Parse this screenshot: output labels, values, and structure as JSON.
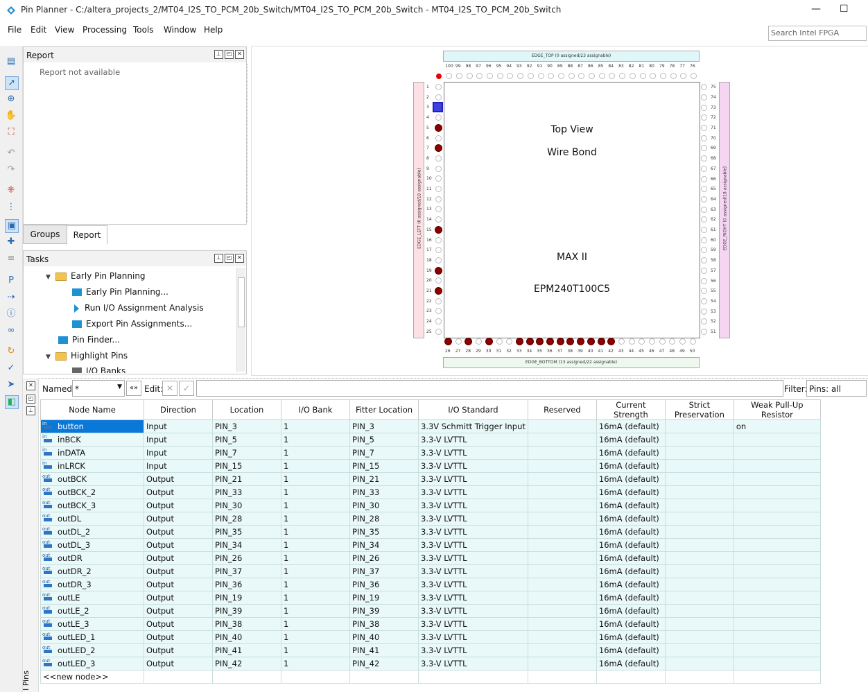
{
  "window": {
    "title": "Pin Planner - C:/altera_projects_2/MT04_I2S_TO_PCM_20b_Switch/MT04_I2S_TO_PCM_20b_Switch - MT04_I2S_TO_PCM_20b_Switch",
    "minimize": "—",
    "maximize": "☐"
  },
  "menu": [
    "File",
    "Edit",
    "View",
    "Processing",
    "Tools",
    "Window",
    "Help"
  ],
  "search": {
    "placeholder": "Search Intel FPGA"
  },
  "report_panel": {
    "title": "Report",
    "message": "Report not available"
  },
  "tabs": {
    "groups": "Groups",
    "report": "Report"
  },
  "tasks_panel": {
    "title": "Tasks",
    "items": [
      {
        "label": "Early Pin Planning"
      },
      {
        "label": "Early Pin Planning..."
      },
      {
        "label": "Run I/O Assignment Analysis"
      },
      {
        "label": "Export Pin Assignments..."
      },
      {
        "label": "Pin Finder..."
      },
      {
        "label": "Highlight Pins"
      },
      {
        "label": "I/O Banks"
      }
    ]
  },
  "chip": {
    "edge_top": "EDGE_TOP (0 assigned/23 assignable)",
    "edge_bottom": "EDGE_BOTTOM (13 assigned/22 assignable)",
    "edge_left": "EDGE_LEFT (6 assigned/18 assignable)",
    "edge_right": "EDGE_RIGHT (0 assigned/18 assignable)",
    "top_view": "Top View",
    "wire_bond": "Wire Bond",
    "family": "MAX II",
    "device": "EPM240T100C5",
    "used_pins_left": [
      3,
      5,
      7,
      15,
      19,
      21
    ],
    "used_pins_bottom": [
      26,
      28,
      30,
      33,
      34,
      35,
      36,
      37,
      38,
      39,
      40,
      41,
      42
    ]
  },
  "filter": {
    "named_label": "Named:",
    "named_value": "*",
    "edit_label": "Edit:",
    "filter_label": "Filter:",
    "filter_value": "Pins: all"
  },
  "table": {
    "columns": [
      "Node Name",
      "Direction",
      "Location",
      "I/O Bank",
      "Fitter Location",
      "I/O Standard",
      "Reserved",
      "Current Strength",
      "Strict Preservation",
      "Weak Pull-Up Resistor"
    ],
    "rows": [
      {
        "name": "button",
        "dir": "Input",
        "loc": "PIN_3",
        "bank": "1",
        "fit": "PIN_3",
        "std": "3.3V Schmitt Trigger Input",
        "cur": "16mA (default)",
        "pull": "on",
        "kind": "in"
      },
      {
        "name": "inBCK",
        "dir": "Input",
        "loc": "PIN_5",
        "bank": "1",
        "fit": "PIN_5",
        "std": "3.3-V LVTTL",
        "cur": "16mA (default)",
        "pull": "",
        "kind": "in"
      },
      {
        "name": "inDATA",
        "dir": "Input",
        "loc": "PIN_7",
        "bank": "1",
        "fit": "PIN_7",
        "std": "3.3-V LVTTL",
        "cur": "16mA (default)",
        "pull": "",
        "kind": "in"
      },
      {
        "name": "inLRCK",
        "dir": "Input",
        "loc": "PIN_15",
        "bank": "1",
        "fit": "PIN_15",
        "std": "3.3-V LVTTL",
        "cur": "16mA (default)",
        "pull": "",
        "kind": "in"
      },
      {
        "name": "outBCK",
        "dir": "Output",
        "loc": "PIN_21",
        "bank": "1",
        "fit": "PIN_21",
        "std": "3.3-V LVTTL",
        "cur": "16mA (default)",
        "pull": "",
        "kind": "out"
      },
      {
        "name": "outBCK_2",
        "dir": "Output",
        "loc": "PIN_33",
        "bank": "1",
        "fit": "PIN_33",
        "std": "3.3-V LVTTL",
        "cur": "16mA (default)",
        "pull": "",
        "kind": "out"
      },
      {
        "name": "outBCK_3",
        "dir": "Output",
        "loc": "PIN_30",
        "bank": "1",
        "fit": "PIN_30",
        "std": "3.3-V LVTTL",
        "cur": "16mA (default)",
        "pull": "",
        "kind": "out"
      },
      {
        "name": "outDL",
        "dir": "Output",
        "loc": "PIN_28",
        "bank": "1",
        "fit": "PIN_28",
        "std": "3.3-V LVTTL",
        "cur": "16mA (default)",
        "pull": "",
        "kind": "out"
      },
      {
        "name": "outDL_2",
        "dir": "Output",
        "loc": "PIN_35",
        "bank": "1",
        "fit": "PIN_35",
        "std": "3.3-V LVTTL",
        "cur": "16mA (default)",
        "pull": "",
        "kind": "out"
      },
      {
        "name": "outDL_3",
        "dir": "Output",
        "loc": "PIN_34",
        "bank": "1",
        "fit": "PIN_34",
        "std": "3.3-V LVTTL",
        "cur": "16mA (default)",
        "pull": "",
        "kind": "out"
      },
      {
        "name": "outDR",
        "dir": "Output",
        "loc": "PIN_26",
        "bank": "1",
        "fit": "PIN_26",
        "std": "3.3-V LVTTL",
        "cur": "16mA (default)",
        "pull": "",
        "kind": "out"
      },
      {
        "name": "outDR_2",
        "dir": "Output",
        "loc": "PIN_37",
        "bank": "1",
        "fit": "PIN_37",
        "std": "3.3-V LVTTL",
        "cur": "16mA (default)",
        "pull": "",
        "kind": "out"
      },
      {
        "name": "outDR_3",
        "dir": "Output",
        "loc": "PIN_36",
        "bank": "1",
        "fit": "PIN_36",
        "std": "3.3-V LVTTL",
        "cur": "16mA (default)",
        "pull": "",
        "kind": "out"
      },
      {
        "name": "outLE",
        "dir": "Output",
        "loc": "PIN_19",
        "bank": "1",
        "fit": "PIN_19",
        "std": "3.3-V LVTTL",
        "cur": "16mA (default)",
        "pull": "",
        "kind": "out"
      },
      {
        "name": "outLE_2",
        "dir": "Output",
        "loc": "PIN_39",
        "bank": "1",
        "fit": "PIN_39",
        "std": "3.3-V LVTTL",
        "cur": "16mA (default)",
        "pull": "",
        "kind": "out"
      },
      {
        "name": "outLE_3",
        "dir": "Output",
        "loc": "PIN_38",
        "bank": "1",
        "fit": "PIN_38",
        "std": "3.3-V LVTTL",
        "cur": "16mA (default)",
        "pull": "",
        "kind": "out"
      },
      {
        "name": "outLED_1",
        "dir": "Output",
        "loc": "PIN_40",
        "bank": "1",
        "fit": "PIN_40",
        "std": "3.3-V LVTTL",
        "cur": "16mA (default)",
        "pull": "",
        "kind": "out"
      },
      {
        "name": "outLED_2",
        "dir": "Output",
        "loc": "PIN_41",
        "bank": "1",
        "fit": "PIN_41",
        "std": "3.3-V LVTTL",
        "cur": "16mA (default)",
        "pull": "",
        "kind": "out"
      },
      {
        "name": "outLED_3",
        "dir": "Output",
        "loc": "PIN_42",
        "bank": "1",
        "fit": "PIN_42",
        "std": "3.3-V LVTTL",
        "cur": "16mA (default)",
        "pull": "",
        "kind": "out"
      }
    ],
    "new_node": "<<new node>>"
  },
  "side_label": "l Pins"
}
